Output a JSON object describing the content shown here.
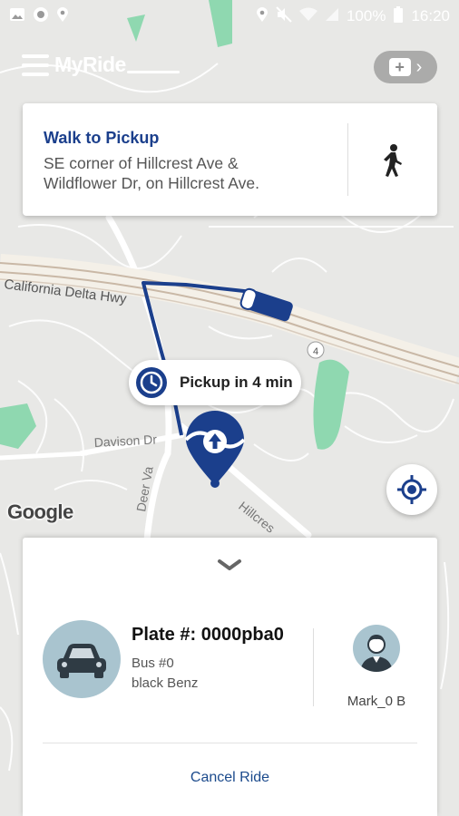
{
  "status_bar": {
    "battery": "100%",
    "time": "16:20",
    "icons": [
      "image-icon",
      "whatsapp-icon",
      "location-icon",
      "location-icon",
      "mute-icon",
      "wifi-icon",
      "signal-icon",
      "battery-icon"
    ]
  },
  "app": {
    "brand": "MyRide",
    "menu_icon": "hamburger-icon",
    "favorites_icon": "add-favorite-icon"
  },
  "walk_card": {
    "title": "Walk to Pickup",
    "address": "SE corner of Hillcrest Ave & Wildflower Dr, on Hillcrest Ave.",
    "icon": "walking-person-icon"
  },
  "map": {
    "road_labels": {
      "highway": "California Delta Hwy",
      "street1": "Davison Dr",
      "street2": "Deer Va",
      "street3": "Hillcres",
      "route_shield": "4"
    },
    "pickup_label": "Pickup in 4 min",
    "attribution": "Google",
    "colors": {
      "route": "#1b3f8c",
      "park": "#8fd8b0"
    }
  },
  "ride": {
    "plate": "Plate #: 0000pba0",
    "bus": "Bus #0",
    "vehicle": "black Benz",
    "driver": "Mark_0 B",
    "cancel_label": "Cancel Ride"
  }
}
